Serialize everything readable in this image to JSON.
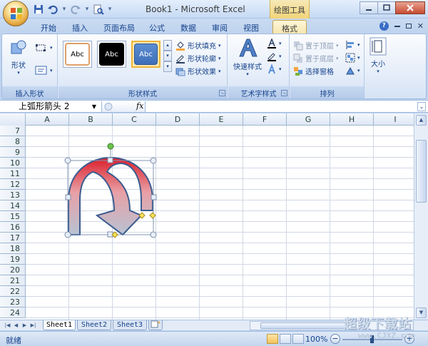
{
  "window": {
    "title": "Book1 - Microsoft Excel",
    "contextual_tab_group": "绘图工具"
  },
  "tabs": [
    "开始",
    "插入",
    "页面布局",
    "公式",
    "数据",
    "审阅",
    "视图",
    "格式"
  ],
  "active_tab": "格式",
  "ribbon": {
    "insert_shapes": {
      "shapes_label": "形状",
      "group_label": "插入形状"
    },
    "shape_styles": {
      "samples": [
        "Abc",
        "Abc",
        "Abc"
      ],
      "fill_label": "形状填充",
      "outline_label": "形状轮廓",
      "effects_label": "形状效果",
      "group_label": "形状样式"
    },
    "wordart_styles": {
      "quick_styles_label": "快速样式",
      "group_label": "艺术字样式"
    },
    "arrange": {
      "bring_front_label": "置于顶层",
      "send_back_label": "置于底层",
      "selection_pane_label": "选择窗格",
      "group_label": "排列"
    },
    "size": {
      "size_label": "大小"
    }
  },
  "formula_bar": {
    "name_box": "上弧形箭头 2",
    "fx_label": "fx",
    "formula": ""
  },
  "grid": {
    "columns": [
      "A",
      "B",
      "C",
      "D",
      "E",
      "F",
      "G",
      "H",
      "I"
    ],
    "rows": [
      "7",
      "8",
      "9",
      "10",
      "11",
      "12",
      "13",
      "14",
      "15",
      "16",
      "17",
      "18",
      "19",
      "20",
      "21",
      "22",
      "23",
      "24"
    ]
  },
  "selected_shape": {
    "name": "上弧形箭头 2",
    "fill_top_color": "#dc1e2a",
    "fill_bottom_color": "#b7c3d3"
  },
  "sheets": [
    "Sheet1",
    "Sheet2",
    "Sheet3"
  ],
  "active_sheet": "Sheet1",
  "status_bar": {
    "ready_text": "就绪",
    "zoom": "100%"
  },
  "watermark": {
    "text": "超级下载站",
    "url": "www.CJXZ.com"
  },
  "colors": {
    "ribbon_bg": "#dfe9f7",
    "contextual_tab": "#f1d479",
    "grid_line": "#d0d7e5",
    "header_text": "#15428b"
  }
}
